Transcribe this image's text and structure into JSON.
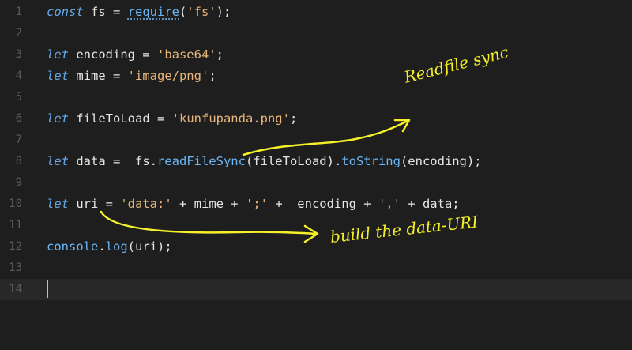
{
  "editor": {
    "lines": [
      {
        "num": "1",
        "tokens": [
          {
            "t": "const",
            "c": "kw"
          },
          {
            "t": " fs = "
          },
          {
            "t": "require",
            "c": "req"
          },
          {
            "t": "("
          },
          {
            "t": "'fs'",
            "c": "str"
          },
          {
            "t": ");"
          }
        ]
      },
      {
        "num": "2",
        "tokens": []
      },
      {
        "num": "3",
        "tokens": [
          {
            "t": "let",
            "c": "kw"
          },
          {
            "t": " encoding = "
          },
          {
            "t": "'base64'",
            "c": "str"
          },
          {
            "t": ";"
          }
        ]
      },
      {
        "num": "4",
        "tokens": [
          {
            "t": "let",
            "c": "kw"
          },
          {
            "t": " mime = "
          },
          {
            "t": "'image/png'",
            "c": "str"
          },
          {
            "t": ";"
          }
        ]
      },
      {
        "num": "5",
        "tokens": []
      },
      {
        "num": "6",
        "tokens": [
          {
            "t": "let",
            "c": "kw"
          },
          {
            "t": " fileToLoad = "
          },
          {
            "t": "'kunfupanda.png'",
            "c": "str"
          },
          {
            "t": ";"
          }
        ]
      },
      {
        "num": "7",
        "tokens": []
      },
      {
        "num": "8",
        "tokens": [
          {
            "t": "let",
            "c": "kw"
          },
          {
            "t": " data =  fs."
          },
          {
            "t": "readFileSync",
            "c": "fn"
          },
          {
            "t": "(fileToLoad)."
          },
          {
            "t": "toString",
            "c": "fn"
          },
          {
            "t": "(encoding);"
          }
        ]
      },
      {
        "num": "9",
        "tokens": []
      },
      {
        "num": "10",
        "tokens": [
          {
            "t": "let",
            "c": "kw"
          },
          {
            "t": " uri = "
          },
          {
            "t": "'data:'",
            "c": "str"
          },
          {
            "t": " + mime + "
          },
          {
            "t": "';'",
            "c": "str"
          },
          {
            "t": " +  encoding + "
          },
          {
            "t": "','",
            "c": "str"
          },
          {
            "t": " + data;"
          }
        ]
      },
      {
        "num": "11",
        "tokens": []
      },
      {
        "num": "12",
        "tokens": [
          {
            "t": "console",
            "c": "fn"
          },
          {
            "t": "."
          },
          {
            "t": "log",
            "c": "fn"
          },
          {
            "t": "(uri);"
          }
        ]
      },
      {
        "num": "13",
        "tokens": []
      },
      {
        "num": "14",
        "tokens": []
      }
    ],
    "current_line": 14
  },
  "annotations": {
    "readfile": "Readfile sync",
    "datauri": "build the data-URI",
    "color": "#f5f02a"
  }
}
